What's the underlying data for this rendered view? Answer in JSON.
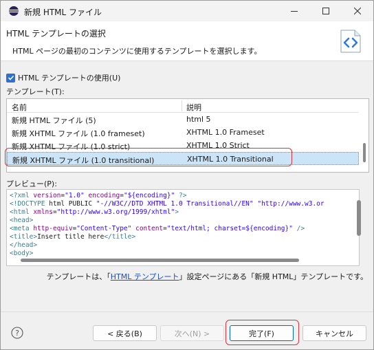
{
  "window": {
    "title": "新規 HTML ファイル"
  },
  "header": {
    "title": "HTML テンプレートの選択",
    "description": "HTML ページの最初のコンテンツに使用するテンプレートを選択します。"
  },
  "use_template_checkbox": {
    "label": "HTML テンプレートの使用(U)",
    "checked": true
  },
  "templates": {
    "label": "テンプレート(T):",
    "columns": [
      "名前",
      "説明"
    ],
    "rows": [
      {
        "name": "新規 HTML ファイル (5)",
        "desc": "html 5"
      },
      {
        "name": "新規 XHTML ファイル (1.0 frameset)",
        "desc": "XHTML 1.0 Frameset"
      },
      {
        "name": "新規 XHTML ファイル (1.0 strict)",
        "desc": "XHTML 1.0 Strict"
      },
      {
        "name": "新規 XHTML ファイル (1.0 transitional)",
        "desc": "XHTML 1.0 Transitional",
        "selected": true
      }
    ]
  },
  "preview": {
    "label": "プレビュー(P):",
    "lines": [
      "<?xml version=\"1.0\" encoding=\"${encoding}\" ?>",
      "<!DOCTYPE html PUBLIC \"-//W3C//DTD XHTML 1.0 Transitional//EN\" \"http://www.w3.or",
      "<html xmlns=\"http://www.w3.org/1999/xhtml\">",
      "<head>",
      "<meta http-equiv=\"Content-Type\" content=\"text/html; charset=${encoding}\" />",
      "<title>Insert title here</title>",
      "</head>",
      "<body>"
    ]
  },
  "note": {
    "before": "テンプレートは、「",
    "link": "HTML テンプレート",
    "after": "」設定ページにある「新規 HTML」テンプレートです。"
  },
  "buttons": {
    "back": "< 戻る(B)",
    "next": "次へ(N) >",
    "finish": "完了(F)",
    "cancel": "キャンセル"
  },
  "colors": {
    "accent": "#0067c0",
    "selection": "#cce4f7",
    "annotation": "#d9323a"
  }
}
